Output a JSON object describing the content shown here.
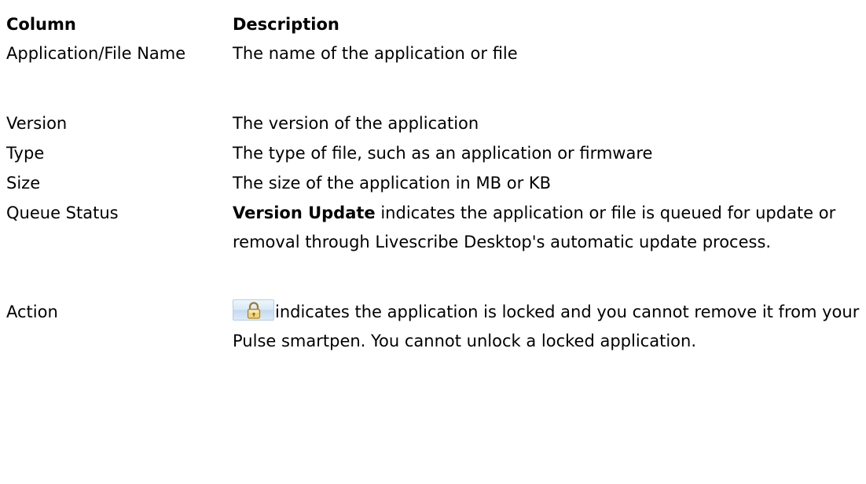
{
  "header": {
    "column": "Column",
    "description": "Description"
  },
  "rows": [
    {
      "name": "Application/File Name",
      "description": "The name of the application or file"
    },
    {
      "name": "Version",
      "description": "The version of the application"
    },
    {
      "name": "Type",
      "description": "The type of file, such as an application or firmware"
    },
    {
      "name": "Size",
      "description": "The size of the application in MB or KB"
    },
    {
      "name": "Queue Status",
      "description_bold": "Version Update",
      "description": " indicates the application or file is queued for update or removal through Livescribe Desktop's automatic update process."
    },
    {
      "name": "Action",
      "icon": "lock-icon",
      "description": "indicates the application is locked and you cannot remove it from your Pulse smartpen. You cannot unlock a locked application."
    }
  ]
}
